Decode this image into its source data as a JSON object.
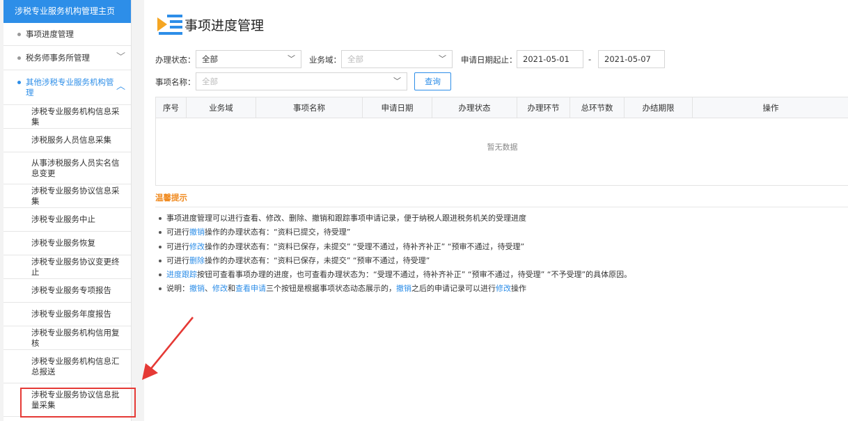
{
  "sidebar": {
    "header": "涉税专业服务机构管理主页",
    "top_items": [
      {
        "label": "事项进度管理"
      },
      {
        "label": "税务师事务所管理"
      },
      {
        "label": "其他涉税专业服务机构管理"
      }
    ],
    "sub_items": [
      {
        "label": "涉税专业服务机构信息采集"
      },
      {
        "label": "涉税服务人员信息采集"
      },
      {
        "label": "从事涉税服务人员实名信息变更"
      },
      {
        "label": "涉税专业服务协议信息采集"
      },
      {
        "label": "涉税专业服务中止"
      },
      {
        "label": "涉税专业服务恢复"
      },
      {
        "label": "涉税专业服务协议变更终止"
      },
      {
        "label": "涉税专业服务专项报告"
      },
      {
        "label": "涉税专业服务年度报告"
      },
      {
        "label": "涉税专业服务机构信用复核"
      },
      {
        "label": "涉税专业服务机构信息汇总报送"
      },
      {
        "label": "涉税专业服务协议信息批量采集"
      }
    ]
  },
  "main": {
    "title": "事项进度管理",
    "filters": {
      "status_label": "办理状态：",
      "status_value": "全部",
      "domain_label": "业务域：",
      "domain_placeholder": "全部",
      "date_label": "申请日期起止：",
      "date_from": "2021-05-01",
      "date_sep": "-",
      "date_to": "2021-05-07",
      "item_label": "事项名称：",
      "item_placeholder": "全部",
      "query_button": "查询"
    },
    "table": {
      "columns": [
        "序号",
        "业务域",
        "事项名称",
        "申请日期",
        "办理状态",
        "办理环节",
        "总环节数",
        "办结期限",
        "操作"
      ],
      "empty_text": "暂无数据"
    },
    "tips": {
      "title": "温馨提示",
      "items": [
        [
          {
            "t": "事项进度管理可以进行查看、修改、删除、撤销和跟踪事项申请记录，便于纳税人跟进税务机关的受理进度"
          }
        ],
        [
          {
            "t": "可进行"
          },
          {
            "t": "撤销",
            "hl": true
          },
          {
            "t": "操作的办理状态有：“资料已提交，待受理”"
          }
        ],
        [
          {
            "t": "可进行"
          },
          {
            "t": "修改",
            "hl": true
          },
          {
            "t": "操作的办理状态有：“资料已保存，未提交”  “受理不通过，待补齐补正”  “预审不通过，待受理”"
          }
        ],
        [
          {
            "t": "可进行"
          },
          {
            "t": "删除",
            "hl": true
          },
          {
            "t": "操作的办理状态有：“资料已保存，未提交”  “预审不通过，待受理”"
          }
        ],
        [
          {
            "t": "进度跟踪",
            "hl": true
          },
          {
            "t": "按钮可查看事项办理的进度，也可查看办理状态为：“受理不通过，待补齐补正”  “预审不通过，待受理”  “不予受理”的具体原因。"
          }
        ],
        [
          {
            "t": "说明："
          },
          {
            "t": "撤销",
            "hl": true
          },
          {
            "t": "、"
          },
          {
            "t": "修改",
            "hl": true
          },
          {
            "t": "和"
          },
          {
            "t": "查看申请",
            "hl": true
          },
          {
            "t": "三个按钮是根据事项状态动态展示的，"
          },
          {
            "t": "撤销",
            "hl": true
          },
          {
            "t": "之后的申请记录可以进行"
          },
          {
            "t": "修改",
            "hl": true
          },
          {
            "t": "操作"
          }
        ]
      ]
    }
  },
  "colors": {
    "accent": "#2d8ee8",
    "tip_title": "#f08a1f",
    "annotation": "#e53935"
  }
}
